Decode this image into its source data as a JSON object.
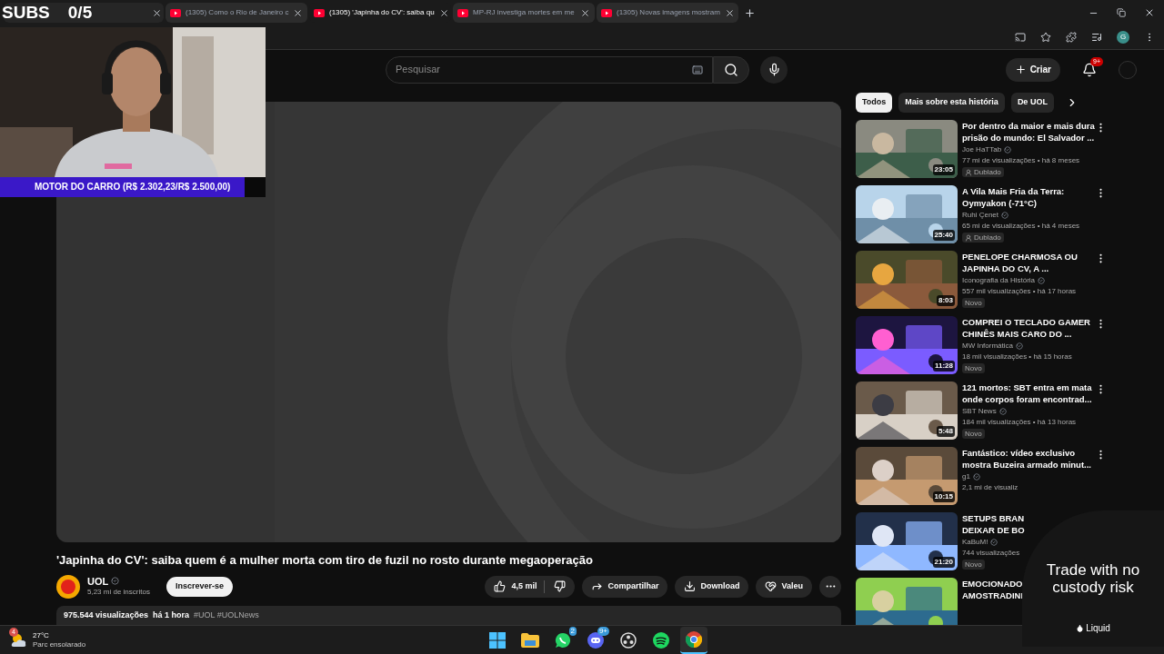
{
  "overlay": {
    "subs_label": "SUBS",
    "subs_count": "0/5",
    "goal": "MOTOR DO CARRO (R$ 2.302,23/R$ 2.500,00)",
    "level": 0.92
  },
  "browser_tabs": [
    {
      "title": "(1305) Como o Rio de Janeiro c",
      "selected": false
    },
    {
      "title": "(1305) 'Japinha do CV': saiba qu",
      "selected": true
    },
    {
      "title": "MP-RJ investiga mortes em me",
      "selected": false
    },
    {
      "title": "(1305) Novas imagens mostram",
      "selected": false
    }
  ],
  "profile_letter": "G",
  "header": {
    "search_placeholder": "Pesquisar",
    "create": "Criar",
    "notifications": "9+"
  },
  "video": {
    "title": "'Japinha do CV': saiba quem é a mulher morta com tiro de fuzil no rosto durante megaoperação",
    "channel": "UOL",
    "subscribers": "5,23 mi de inscritos",
    "subscribe": "Inscrever-se",
    "likes": "4,5 mil",
    "share": "Compartilhar",
    "download": "Download",
    "thanks": "Valeu",
    "views": "975.544 visualizações",
    "age": "há 1 hora",
    "hashtags": "#UOL #UOLNews"
  },
  "chips": [
    {
      "label": "Todos",
      "selected": true
    },
    {
      "label": "Mais sobre esta história",
      "selected": false
    },
    {
      "label": "De UOL",
      "selected": false
    }
  ],
  "related": [
    {
      "title": [
        "Por dentro da maior e mais dura",
        "prisão do mundo: El Salvador ..."
      ],
      "channel": "Joe HaTTab",
      "meta": "77 mi de visualizações • há 8 meses",
      "badge": "Dublado",
      "badge_icon": true,
      "duration": "23:05"
    },
    {
      "title": [
        "A Vila Mais Fria da Terra:",
        "Oymyakon (-71°C)"
      ],
      "channel": "Ruhi Çenet",
      "meta": "65 mi de visualizações • há 4 meses",
      "badge": "Dublado",
      "badge_icon": true,
      "duration": "25:40"
    },
    {
      "title": [
        "PENELOPE CHARMOSA OU",
        "JAPINHA DO CV, A ..."
      ],
      "channel": "Iconografia da História",
      "meta": "557 mil visualizações • há 17 horas",
      "badge": "Novo",
      "badge_icon": false,
      "duration": "8:03"
    },
    {
      "title": [
        "COMPREI O TECLADO GAMER",
        "CHINÊS MAIS CARO DO ..."
      ],
      "channel": "MW Informática",
      "meta": "18 mil visualizações • há 15 horas",
      "badge": "Novo",
      "badge_icon": false,
      "duration": "11:28"
    },
    {
      "title": [
        "121 mortos: SBT entra em mata",
        "onde corpos foram encontrad..."
      ],
      "channel": "SBT News",
      "meta": "184 mil visualizações • há 13 horas",
      "badge": "Novo",
      "badge_icon": false,
      "duration": "5:48"
    },
    {
      "title": [
        "Fantástico: vídeo exclusivo",
        "mostra Buzeira armado minut..."
      ],
      "channel": "g1",
      "meta": "2,1 mi de visualiz",
      "duration": "10:15"
    },
    {
      "title": [
        "SETUPS BRAN",
        "DEIXAR DE BO"
      ],
      "channel": "KaBuM!",
      "meta": "744 visualizações",
      "badge": "Novo",
      "badge_icon": false,
      "duration": "21:20"
    },
    {
      "title": [
        "EMOCIONADO",
        "AMOSTRADINI"
      ]
    }
  ],
  "ad": {
    "headline": "Trade with no custody risk",
    "brand": "Liquid"
  },
  "taskbar": {
    "weather_badge": "4",
    "temperature": "27°C",
    "condition": "Parc ensolarado",
    "apps": [
      {
        "kind": "start",
        "selected": false
      },
      {
        "kind": "folder",
        "selected": false
      },
      {
        "kind": "whatsapp",
        "badge": "2",
        "selected": false
      },
      {
        "kind": "discord",
        "badge": "9+",
        "selected": false
      },
      {
        "kind": "obs",
        "selected": false
      },
      {
        "kind": "spotify",
        "selected": false
      },
      {
        "kind": "chrome",
        "selected": true
      }
    ]
  }
}
